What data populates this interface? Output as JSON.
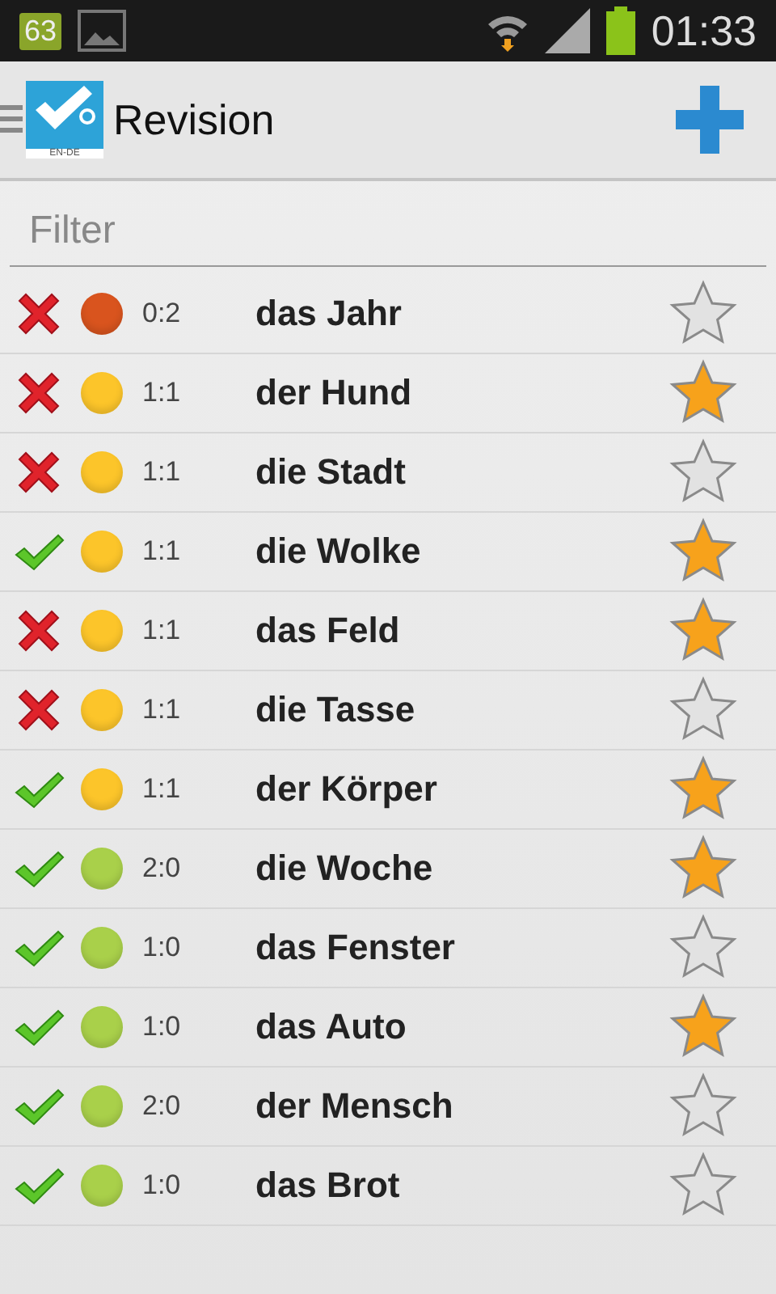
{
  "status_bar": {
    "notification_count": "63",
    "time": "01:33"
  },
  "action_bar": {
    "logo_caption": "EN-DE",
    "title": "Revision"
  },
  "filter": {
    "placeholder": "Filter"
  },
  "rows": [
    {
      "correct": false,
      "color": "#d9541e",
      "score": "0:2",
      "word": "das Jahr",
      "starred": false
    },
    {
      "correct": false,
      "color": "#fcc52a",
      "score": "1:1",
      "word": "der Hund",
      "starred": true
    },
    {
      "correct": false,
      "color": "#fcc52a",
      "score": "1:1",
      "word": "die Stadt",
      "starred": false
    },
    {
      "correct": true,
      "color": "#fcc52a",
      "score": "1:1",
      "word": "die Wolke",
      "starred": true
    },
    {
      "correct": false,
      "color": "#fcc52a",
      "score": "1:1",
      "word": "das Feld",
      "starred": true
    },
    {
      "correct": false,
      "color": "#fcc52a",
      "score": "1:1",
      "word": "die Tasse",
      "starred": false
    },
    {
      "correct": true,
      "color": "#fcc52a",
      "score": "1:1",
      "word": "der Körper",
      "starred": true
    },
    {
      "correct": true,
      "color": "#a9d04a",
      "score": "2:0",
      "word": "die Woche",
      "starred": true
    },
    {
      "correct": true,
      "color": "#a9d04a",
      "score": "1:0",
      "word": "das Fenster",
      "starred": false
    },
    {
      "correct": true,
      "color": "#a9d04a",
      "score": "1:0",
      "word": "das Auto",
      "starred": true
    },
    {
      "correct": true,
      "color": "#a9d04a",
      "score": "2:0",
      "word": "der Mensch",
      "starred": false
    },
    {
      "correct": true,
      "color": "#a9d04a",
      "score": "1:0",
      "word": "das Brot",
      "starred": false
    }
  ]
}
